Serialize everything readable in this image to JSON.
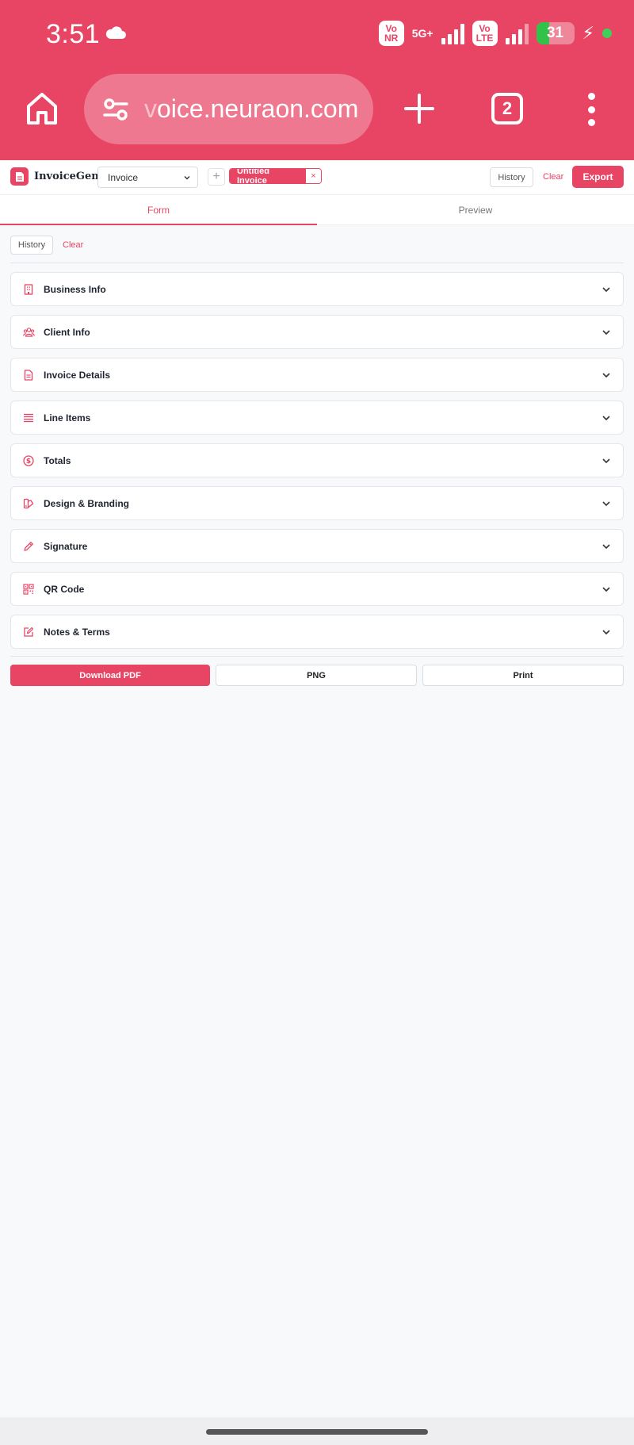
{
  "status_bar": {
    "time": "3:51",
    "network_badge_1": [
      "Vo",
      "NR"
    ],
    "network_type": "5G+",
    "network_badge_2": [
      "Vo",
      "LTE"
    ],
    "battery_level": "31"
  },
  "browser": {
    "url": "voice.neuraon.com",
    "url_faded_prefix": "v",
    "url_rest": "oice.neuraon.com",
    "tab_count": "2"
  },
  "app": {
    "brand": "InvoiceGen",
    "doc_type_selected": "Invoice",
    "add_tab_symbol": "+",
    "active_tab": "Untitled Invoice",
    "close_symbol": "×",
    "history_label": "History",
    "clear_label": "Clear",
    "export_label": "Export",
    "accent_color": "#e84565"
  },
  "view_tabs": [
    {
      "label": "Form",
      "active": true
    },
    {
      "label": "Preview",
      "active": false
    }
  ],
  "toolbar": {
    "history_label": "History",
    "clear_label": "Clear"
  },
  "sections": [
    {
      "label": "Business Info",
      "icon": "building-icon"
    },
    {
      "label": "Client Info",
      "icon": "users-icon"
    },
    {
      "label": "Invoice Details",
      "icon": "document-icon"
    },
    {
      "label": "Line Items",
      "icon": "list-icon"
    },
    {
      "label": "Totals",
      "icon": "dollar-icon"
    },
    {
      "label": "Design & Branding",
      "icon": "palette-icon"
    },
    {
      "label": "Signature",
      "icon": "pen-icon"
    },
    {
      "label": "QR Code",
      "icon": "qr-code-icon"
    },
    {
      "label": "Notes & Terms",
      "icon": "edit-icon"
    }
  ],
  "actions": {
    "download_pdf": "Download PDF",
    "png": "PNG",
    "print": "Print"
  }
}
